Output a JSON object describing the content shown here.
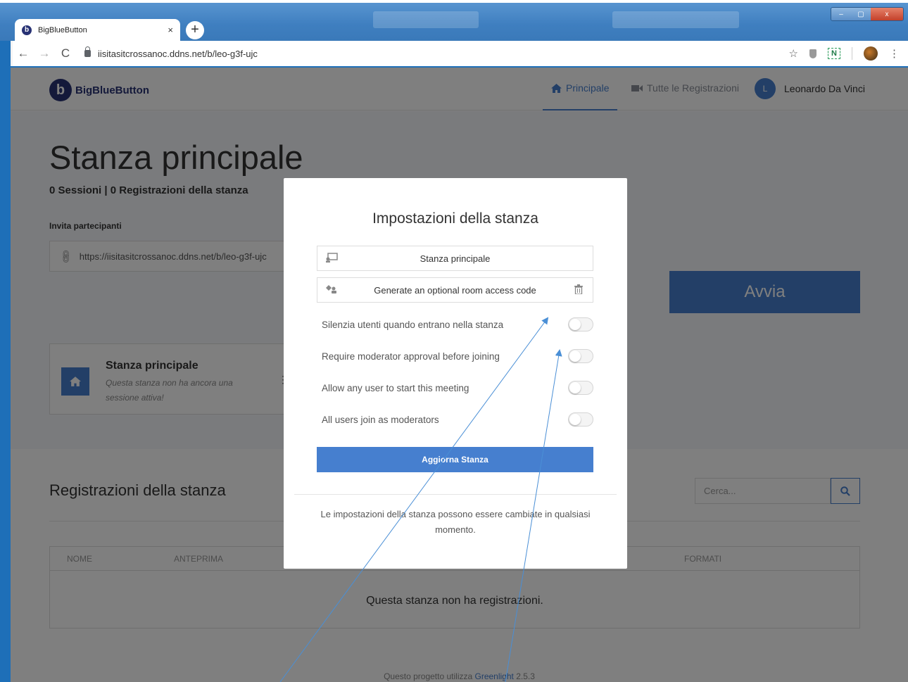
{
  "browser": {
    "tab_title": "BigBlueButton",
    "tab_close": "×",
    "new_tab": "+",
    "back": "←",
    "forward": "→",
    "reload": "C",
    "url": "iisitasitcrossanoc.ddns.net/b/leo-g3f-ujc",
    "star": "☆",
    "ext_n": "N",
    "menu": "⋮",
    "win_minimize": "–",
    "win_maximize": "▢",
    "win_close": "x"
  },
  "navbar": {
    "logo_glyph": "b",
    "logo_text": "BigBlueButton",
    "home_icon": "home-icon",
    "home_label": "Principale",
    "rec_icon": "video-camera-icon",
    "rec_label": "Tutte le Registrazioni",
    "user_initial": "L",
    "user_name": "Leonardo Da Vinci"
  },
  "room": {
    "title": "Stanza principale",
    "stats": "0 Sessioni | 0 Registrazioni della stanza",
    "invite_label": "Invita partecipanti",
    "invite_url": "https://iisitasitcrossanoc.ddns.net/b/leo-g3f-ujc",
    "start_label": "Avvia",
    "card_name": "Stanza principale",
    "card_desc": "Questa stanza non ha ancora una sessione attiva!",
    "card_menu": "⋮"
  },
  "recordings": {
    "title": "Registrazioni della stanza",
    "search_placeholder": "Cerca...",
    "columns": [
      "NOME",
      "ANTEPRIMA",
      "FORMATI"
    ],
    "empty": "Questa stanza non ha registrazioni."
  },
  "footer": {
    "prefix": "Questo progetto utilizza ",
    "link": "Greenlight",
    "suffix": " 2.5.3"
  },
  "modal": {
    "title": "Impostazioni della stanza",
    "room_name": "Stanza principale",
    "access_code": "Generate an optional room access code",
    "options": [
      {
        "label": "Silenzia utenti quando entrano nella stanza",
        "enabled": false
      },
      {
        "label": "Require moderator approval before joining",
        "enabled": false
      },
      {
        "label": "Allow any user to start this meeting",
        "enabled": false
      },
      {
        "label": "All users join as moderators",
        "enabled": false
      }
    ],
    "update_label": "Aggiorna Stanza",
    "note": "Le impostazioni della stanza possono essere cambiate in qualsiasi momento."
  },
  "colors": {
    "primary": "#467fcf",
    "brand": "#283274",
    "annotation": "#4a8fd6"
  }
}
